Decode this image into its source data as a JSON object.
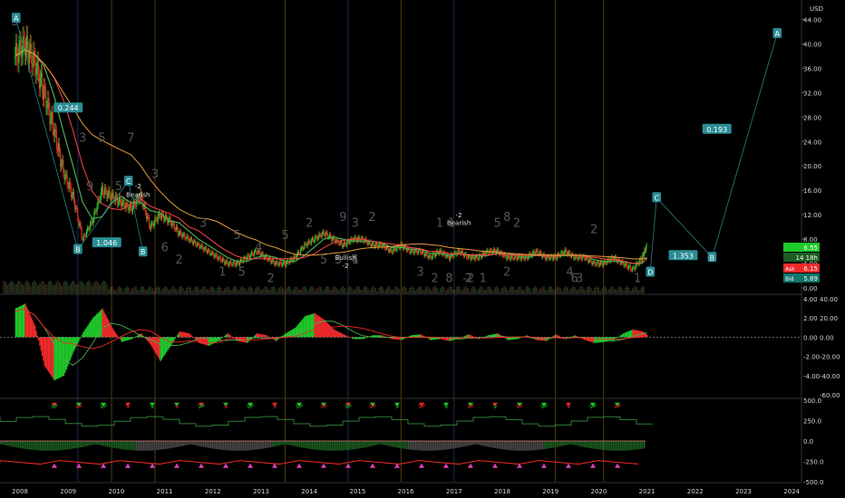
{
  "currency_label": "USD",
  "colors": {
    "background": "#000000",
    "up": "#1ec92a",
    "down": "#ef2a2a",
    "ma_green": "#4caf50",
    "ma_orange": "#e39a3b",
    "ma_red": "#ff4444",
    "pattern": "#2a8d95",
    "axis_text": "#d1d4dc",
    "grid_vert_blue": "#1f3a66",
    "grid_vert_orange": "#6b4a12",
    "signal_green": "#1ec92a",
    "signal_pink": "#e040c0",
    "signal_cyan": "#38e0d0"
  },
  "chart_data": [
    {
      "type": "line",
      "name": "price-panel",
      "x_ticks": [
        "2008",
        "2009",
        "2010",
        "2011",
        "2012",
        "2013",
        "2014",
        "2015",
        "2016",
        "2017",
        "2018",
        "2019",
        "2020",
        "2021",
        "2022",
        "2023",
        "2024"
      ],
      "y_ticks": [
        0,
        4,
        8,
        12,
        16,
        20,
        24,
        28,
        32,
        36,
        40,
        44
      ],
      "y_tick_labels": [
        "0.00",
        "4.00",
        "8.00",
        "12.00",
        "16.00",
        "20.00",
        "24.00",
        "28.00",
        "32.00",
        "36.00",
        "40.00",
        "44.00"
      ],
      "ylim": [
        0,
        46
      ],
      "x": [
        2007.9,
        2008.1,
        2008.3,
        2008.5,
        2008.7,
        2008.9,
        2009.1,
        2009.3,
        2009.5,
        2009.7,
        2009.9,
        2010.1,
        2010.3,
        2010.5,
        2010.7,
        2010.9,
        2011.1,
        2011.3,
        2011.5,
        2011.7,
        2011.9,
        2012.1,
        2012.3,
        2012.5,
        2012.7,
        2012.9,
        2013.1,
        2013.3,
        2013.5,
        2013.7,
        2013.9,
        2014.1,
        2014.3,
        2014.5,
        2014.7,
        2014.9,
        2015.1,
        2015.3,
        2015.5,
        2015.7,
        2015.9,
        2016.1,
        2016.3,
        2016.5,
        2016.7,
        2016.9,
        2017.1,
        2017.3,
        2017.5,
        2017.7,
        2017.9,
        2018.1,
        2018.3,
        2018.5,
        2018.7,
        2018.9,
        2019.1,
        2019.3,
        2019.5,
        2019.7,
        2019.9,
        2020.1,
        2020.3,
        2020.5,
        2020.7,
        2020.9,
        2021.0
      ],
      "series": [
        {
          "values": [
            38,
            40,
            37,
            32,
            26,
            19,
            15,
            8,
            11,
            16,
            15,
            14,
            13,
            15,
            10,
            12,
            11,
            9,
            8,
            7,
            6,
            5,
            4,
            4,
            5,
            6,
            5,
            4,
            4,
            5,
            7,
            8,
            9,
            8,
            7,
            8,
            8,
            7,
            7,
            6,
            7,
            6,
            6,
            5,
            6,
            5,
            6,
            5,
            5,
            6,
            6,
            5,
            5,
            5,
            6,
            5,
            5,
            6,
            5,
            5,
            4,
            4,
            5,
            4,
            3,
            5,
            7
          ]
        }
      ],
      "annotations": [
        {
          "label": "A",
          "x": 2007.92,
          "y": 44.2
        },
        {
          "label": "0.244",
          "x": 2009.0,
          "y": 29.5
        },
        {
          "label": "C",
          "x": 2010.25,
          "y": 17.5
        },
        {
          "label": "B",
          "x": 2009.2,
          "y": 6.3
        },
        {
          "label": "1.046",
          "x": 2009.8,
          "y": 7.4
        },
        {
          "label": "B",
          "x": 2010.55,
          "y": 5.9
        },
        {
          "label": "-2",
          "x": 2010.45,
          "y": 16.3
        },
        {
          "label": "Bearish",
          "x": 2010.45,
          "y": 14.9
        },
        {
          "label": "Bullish",
          "x": 2014.75,
          "y": 4.6
        },
        {
          "label": "-2",
          "x": 2014.75,
          "y": 3.3
        },
        {
          "label": "-2",
          "x": 2017.1,
          "y": 11.6
        },
        {
          "label": "Bearish",
          "x": 2017.1,
          "y": 10.3
        },
        {
          "label": "0.193",
          "x": 2022.45,
          "y": 26.0
        },
        {
          "label": "A",
          "x": 2023.7,
          "y": 41.7
        },
        {
          "label": "C",
          "x": 2021.2,
          "y": 14.8
        },
        {
          "label": "1.353",
          "x": 2021.75,
          "y": 5.3
        },
        {
          "label": "B",
          "x": 2022.35,
          "y": 5.0
        },
        {
          "label": "D",
          "x": 2021.07,
          "y": 2.6
        }
      ],
      "pattern_lines": [
        [
          [
            2007.92,
            44.0
          ],
          [
            2009.2,
            6.3
          ],
          [
            2010.25,
            17.5
          ],
          [
            2010.55,
            5.9
          ]
        ],
        [
          [
            2021.07,
            2.8
          ],
          [
            2021.2,
            14.8
          ],
          [
            2022.35,
            5.0
          ],
          [
            2023.7,
            41.7
          ]
        ]
      ],
      "price_labels": [
        {
          "tag": "",
          "value": "6.55"
        },
        {
          "tag": "",
          "value": "14 18h"
        },
        {
          "tag": "Ask",
          "value": "6.15"
        },
        {
          "tag": "Bid",
          "value": "5.69"
        }
      ],
      "count_labels": [
        "3",
        "3",
        "9",
        "5",
        "5",
        "7",
        "3",
        "4",
        "6",
        "2",
        "3",
        "5",
        "1",
        "5",
        "4",
        "5",
        "2",
        "5",
        "2",
        "3",
        "1",
        "3",
        "9",
        "4",
        "2",
        "8",
        "2",
        "3",
        "1",
        "1",
        "2",
        "-2",
        "1",
        "5",
        "2",
        "8",
        "2",
        "4",
        "6",
        "3",
        "2",
        "1"
      ]
    },
    {
      "type": "bar",
      "name": "oscillator-panel-1",
      "y_ticks_right": [
        40,
        20,
        0,
        -20,
        -40,
        -60
      ],
      "y_tick_labels_right": [
        "40.00",
        "20.00",
        "0.00",
        "-20.00",
        "-40.00",
        "-60.00"
      ],
      "y_ticks_left": [
        4,
        2,
        0,
        -2,
        -4
      ],
      "y_tick_labels_left": [
        "4.00",
        "2.00",
        "0.00",
        "-2.00",
        "-4.00"
      ],
      "ylim": [
        -60,
        40
      ],
      "x": [
        2007.9,
        2008.1,
        2008.3,
        2008.5,
        2008.7,
        2008.9,
        2009.1,
        2009.3,
        2009.5,
        2009.7,
        2009.9,
        2010.1,
        2010.3,
        2010.5,
        2010.7,
        2010.9,
        2011.1,
        2011.3,
        2011.5,
        2011.7,
        2011.9,
        2012.1,
        2012.3,
        2012.5,
        2012.7,
        2012.9,
        2013.1,
        2013.3,
        2013.5,
        2013.7,
        2013.9,
        2014.1,
        2014.3,
        2014.5,
        2014.7,
        2014.9,
        2015.1,
        2015.3,
        2015.5,
        2015.7,
        2015.9,
        2016.1,
        2016.3,
        2016.5,
        2016.7,
        2016.9,
        2017.1,
        2017.3,
        2017.5,
        2017.7,
        2017.9,
        2018.1,
        2018.3,
        2018.5,
        2018.7,
        2018.9,
        2019.1,
        2019.3,
        2019.5,
        2019.7,
        2019.9,
        2020.1,
        2020.3,
        2020.5,
        2020.7,
        2020.9,
        2021.0
      ],
      "series": [
        {
          "values": [
            30,
            35,
            12,
            -30,
            -45,
            -40,
            -15,
            5,
            20,
            30,
            10,
            -5,
            -2,
            4,
            -8,
            -25,
            -10,
            6,
            4,
            -6,
            -9,
            -4,
            4,
            -4,
            -6,
            4,
            2,
            -4,
            4,
            10,
            22,
            25,
            18,
            8,
            3,
            -2,
            -2,
            2,
            2,
            -2,
            -3,
            2,
            3,
            -3,
            -2,
            -4,
            -1,
            3,
            -2,
            2,
            4,
            -3,
            -2,
            2,
            -3,
            -4,
            3,
            -2,
            2,
            -3,
            -6,
            -5,
            -3,
            4,
            8,
            6,
            2
          ]
        }
      ]
    },
    {
      "type": "line",
      "name": "indicator-panel-2",
      "y_ticks_right": [
        500,
        250,
        0,
        -250,
        -500
      ],
      "y_tick_labels_right": [
        "500.0",
        "250.0",
        "0.0",
        "-250.0",
        "-500.0"
      ],
      "ylim": [
        -500,
        500
      ],
      "signal_labels": [
        "9P",
        "9P",
        "9P",
        "9",
        "9",
        "9",
        "9P",
        "9",
        "9P",
        "9",
        "9P",
        "9P",
        "9P",
        "9P",
        "9",
        "9P",
        "9",
        "9P",
        "9",
        "9P",
        "9P",
        "9",
        "9P",
        "9P"
      ]
    }
  ]
}
